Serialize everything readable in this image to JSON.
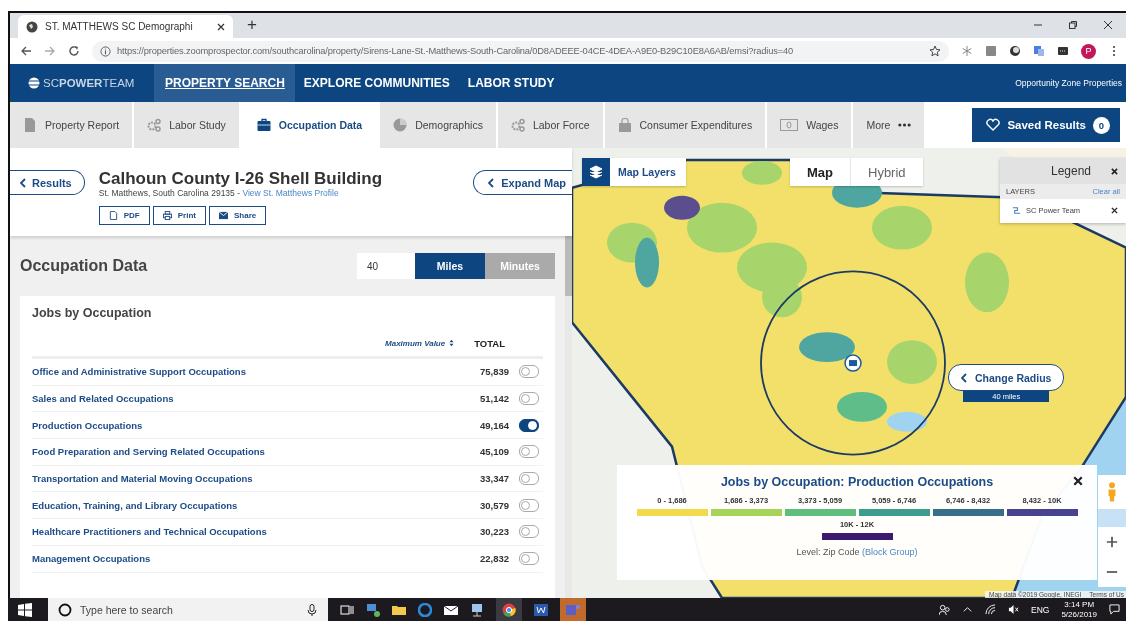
{
  "browser": {
    "tab_title": "ST. MATTHEWS SC Demographi",
    "new_tab": "+",
    "url": "https://properties.zoomprospector.com/southcarolina/property/Sirens-Lane-St.-Matthews-South-Carolina/0D8ADEEE-04CE-4DEA-A9E0-B29C10E8A6AB/emsi?radius=40",
    "profile": "P"
  },
  "nav": {
    "logo": "SC**POWER**TEAM",
    "items": [
      {
        "label": "PROPERTY SEARCH",
        "selected": true
      },
      {
        "label": "EXPLORE COMMUNITIES",
        "selected": false
      },
      {
        "label": "LABOR STUDY",
        "selected": false
      }
    ],
    "right_link": "Opportunity Zone Properties"
  },
  "sub_tabs": [
    {
      "label": "Property Report",
      "kind": "document",
      "selected": false
    },
    {
      "label": "Labor Study",
      "kind": "gears",
      "selected": false
    },
    {
      "label": "Occupation Data",
      "kind": "briefcase",
      "selected": true
    },
    {
      "label": "Demographics",
      "kind": "pie",
      "selected": false
    },
    {
      "label": "Labor Force",
      "kind": "gears",
      "selected": false
    },
    {
      "label": "Consumer Expenditures",
      "kind": "bag",
      "selected": false
    },
    {
      "label": "Wages",
      "kind": "banknote",
      "selected": false
    },
    {
      "label": "More",
      "kind": "dots",
      "selected": false
    }
  ],
  "saved": {
    "label": "Saved Results",
    "count": "0"
  },
  "property": {
    "back": "Results",
    "title": "Calhoun County I-26 Shell Building",
    "address": "St. Matthews, South Carolina 29135 - ",
    "profile_link": "View St. Matthews Profile",
    "actions": [
      {
        "label": "PDF",
        "kind": "pdf"
      },
      {
        "label": "Print",
        "kind": "print"
      },
      {
        "label": "Share",
        "kind": "mail"
      }
    ],
    "expand": "Expand Map"
  },
  "occupation": {
    "heading": "Occupation Data",
    "radius": "40",
    "units": [
      {
        "label": "Miles",
        "selected": true
      },
      {
        "label": "Minutes",
        "selected": false
      }
    ],
    "card_title": "Jobs by Occupation",
    "sort_label": "Maximum Value",
    "total_label": "TOTAL",
    "rows": [
      {
        "name": "Office and Administrative Support Occupations",
        "total": "75,839",
        "on": false
      },
      {
        "name": "Sales and Related Occupations",
        "total": "51,142",
        "on": false
      },
      {
        "name": "Production Occupations",
        "total": "49,164",
        "on": true
      },
      {
        "name": "Food Preparation and Serving Related Occupations",
        "total": "45,109",
        "on": false
      },
      {
        "name": "Transportation and Material Moving Occupations",
        "total": "33,347",
        "on": false
      },
      {
        "name": "Education, Training, and Library Occupations",
        "total": "30,579",
        "on": false
      },
      {
        "name": "Healthcare Practitioners and Technical Occupations",
        "total": "30,223",
        "on": false
      },
      {
        "name": "Management Occupations",
        "total": "22,832",
        "on": false
      }
    ]
  },
  "map": {
    "layers_button": "Map Layers",
    "types": [
      {
        "label": "Map",
        "selected": true
      },
      {
        "label": "Hybrid",
        "selected": false
      }
    ],
    "legend": {
      "title": "Legend",
      "section": "LAYERS",
      "clear": "Clear all",
      "layers": [
        "SC Power Team"
      ]
    },
    "change_radius": "Change Radius",
    "radius_label": "40 miles",
    "choropleth": {
      "title": "Jobs by Occupation: Production Occupations",
      "bins": [
        {
          "label": "0 - 1,686",
          "color": "#f2da4c"
        },
        {
          "label": "1,686 - 3,373",
          "color": "#a6d45a"
        },
        {
          "label": "3,373 - 5,059",
          "color": "#5fbd7d"
        },
        {
          "label": "5,059 - 6,746",
          "color": "#3c9c8e"
        },
        {
          "label": "6,746 - 8,432",
          "color": "#376f8b"
        },
        {
          "label": "8,432 - 10K",
          "color": "#48438f"
        },
        {
          "label": "10K - 12K",
          "color": "#3d1a6d"
        }
      ],
      "level_label": "Level: Zip Code",
      "level_link": "(Block Group)"
    },
    "attribution": "Map data ©2019 Google, INEGI",
    "terms": "Terms of Us"
  },
  "taskbar": {
    "search_placeholder": "Type here to search",
    "language": "ENG",
    "time": "3:14 PM",
    "date": "5/26/2019"
  }
}
